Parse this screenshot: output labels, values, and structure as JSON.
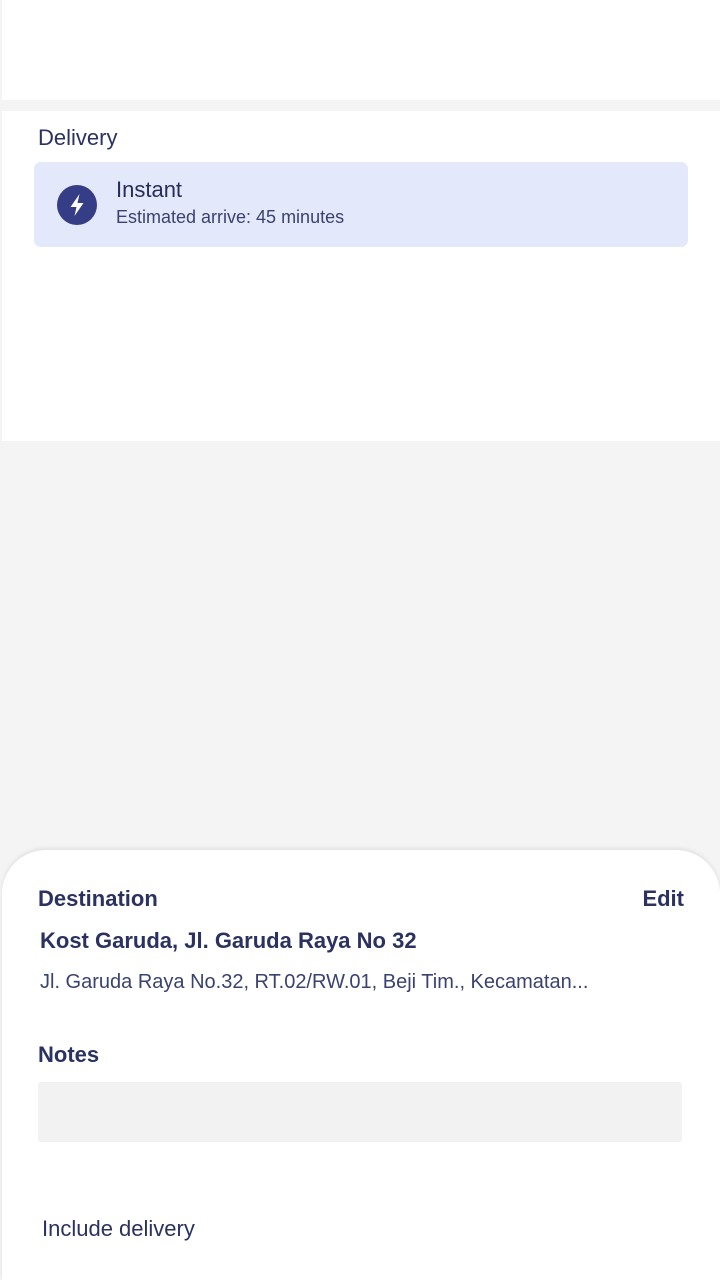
{
  "delivery": {
    "title": "Delivery",
    "option": {
      "icon": "lightning-bolt-icon",
      "name": "Instant",
      "description": "Estimated arrive: 45 minutes"
    }
  },
  "destination": {
    "label": "Destination",
    "edit_label": "Edit",
    "name": "Kost Garuda, Jl. Garuda Raya No 32",
    "address": "Jl. Garuda Raya No.32, RT.02/RW.01, Beji Tim., Kecamatan..."
  },
  "notes": {
    "label": "Notes",
    "value": "",
    "placeholder": ""
  },
  "footer": {
    "include_label": "Include delivery"
  },
  "colors": {
    "accent": "#343d86",
    "option_background": "#e3e8fb",
    "text_primary": "#2b3260",
    "page_background": "#f4f4f4"
  }
}
